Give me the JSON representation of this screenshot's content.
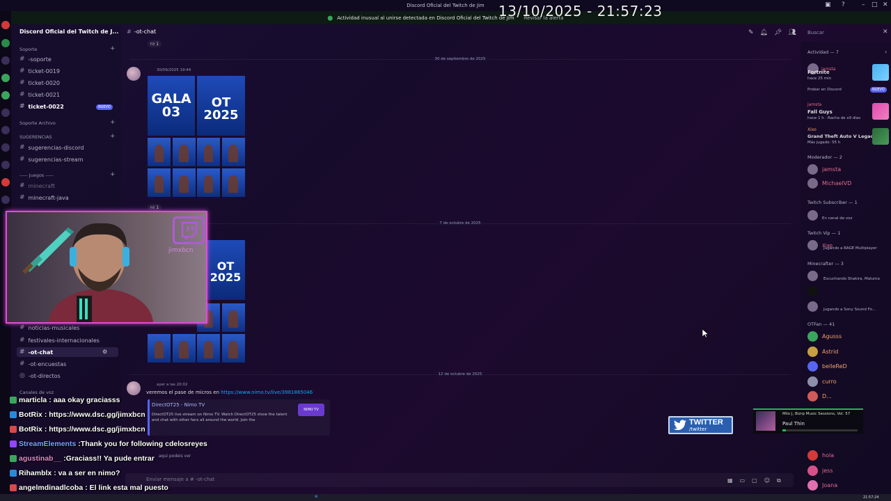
{
  "window": {
    "title": "Discord Oficial del Twitch de Jim"
  },
  "notice": {
    "text": "Actividad inusual al unirse detectada en Discord Oficial del Twitch de Jim",
    "action": "Revisar la alerta"
  },
  "overlay_timestamp": "13/10/2025 - 21:57:23",
  "sidebar": {
    "server_name": "Discord Oficial del Twitch de J...",
    "categories": {
      "soporte": "Soporte",
      "soporte_archivo": "Soporte Archivo",
      "sugerencias": "SUGERENCIAS",
      "juegos": "----- Juegos -----",
      "canales_voz": "Canales de voz"
    },
    "channels": {
      "soporte": "-soporte",
      "t19": "ticket-0019",
      "t20": "ticket-0020",
      "t21": "ticket-0021",
      "t22": "ticket-0022",
      "sug_discord": "sugerencias-discord",
      "sug_stream": "sugerencias-stream",
      "minecraft": "minecraft",
      "minecraft_java": "minecraft-java",
      "noticias": "noticias-musicales",
      "festivales": "festivales-internacionales",
      "ot_chat": "-ot-chat",
      "ot_encuestas": "-ot-encuestas",
      "ot_directos": "-ot-directos"
    },
    "new_badge": "NUEVO"
  },
  "header": {
    "channel": "-ot-chat",
    "search_placeholder": "Buscar"
  },
  "messages": {
    "date1": "30 de septiembre de 2025",
    "date2": "7 de octubre de 2025",
    "date3": "12 de octubre de 2025",
    "msg1_meta": "30/09/2025 19:44",
    "msg3_meta": "ayer a las 20:02",
    "reaction1": "1",
    "reaction2": "1",
    "gala_label": "GALA 03",
    "ot_label": "OT 2025",
    "link_prefix": "veremos el pase de micros en",
    "link_url": "https://www.nimo.tv/live/3981865046",
    "embed_title": "DirectOT25 - Nimo TV",
    "embed_desc": "DirectOT25 live stream on Nimo TV. Watch DirectOT25 show the talent and chat with other fans all around the world. Join the",
    "embed_logo": "NIMO TV",
    "reply_hint": "aqui podeis ver",
    "composer_placeholder": "Enviar mensaje a # -ot-chat"
  },
  "webcam": {
    "name": "jimxbcn"
  },
  "chat_overlay": [
    {
      "user": "marticla",
      "text": ": aaa okay graciasss",
      "color": "#ffffff"
    },
    {
      "user": "BotRix",
      "text": ": https://www.dsc.gg/jimxbcn",
      "color": "#ffffff"
    },
    {
      "user": "BotRix",
      "text": ": https://www.dsc.gg/jimxbcn",
      "color": "#ffffff"
    },
    {
      "user": "StreamElements",
      "text": ":Thank you for following cdelosreyes",
      "color": "#7aa3ff"
    },
    {
      "user": "agustinab__",
      "text": ":Graciass!! Ya pude entrar",
      "color": "#e08ac8"
    },
    {
      "user": "Rihamblx",
      "text": ": va a ser en nimo?",
      "color": "#ffffff"
    },
    {
      "user": "angelmdinadlcoba",
      "text": ": El link esta mal puesto",
      "color": "#ffffff"
    }
  ],
  "right_panel": {
    "activity_head": "Actividad — 7",
    "a1_user": "jamsta",
    "a1_game": "Fortnite",
    "a1_time": "hace 25 min",
    "a1_action": "Probar en Discord",
    "a1_badge": "NUEVO",
    "a2_user": "jamsta",
    "a2_game": "Fall Guys",
    "a2_time": "hace 1 h · Racha de x9 días",
    "a3_user": "Xixo",
    "a3_game": "Grand Theft Auto V Legacy",
    "a3_time": "Más jugado: 55 h",
    "mod_head": "Moderador — 2",
    "mod1": "jamsta",
    "mod2": "MichaelVD",
    "sub_head": "Twitch Subscriber — 1",
    "sub1_status": "En canal de voz",
    "vip_head": "Twitch Vip — 1",
    "vip1": "Xixo",
    "vip1_status": "Jugando a RAGE Multiplayer",
    "mc_head": "Minecrafter — 3",
    "mc1_status": "Escuchando Shakira, Maluma",
    "mc3_status": "Jugando a Sony Sound Fo...",
    "ot_head": "OTFan — 41",
    "members": [
      "Agusss",
      "Astrid",
      "belleReD",
      "curro",
      "D..."
    ],
    "members2": [
      "hola",
      "jess",
      "Joana"
    ]
  },
  "twitter": {
    "label": "TWITTER",
    "handle": "/twitter"
  },
  "music": {
    "title": "Milo J, Bizrp Music Sessions, Vol. 57",
    "artist": "Paul Thin",
    "progress": 0.05
  },
  "taskbar": {
    "clock": "21:57:24"
  }
}
